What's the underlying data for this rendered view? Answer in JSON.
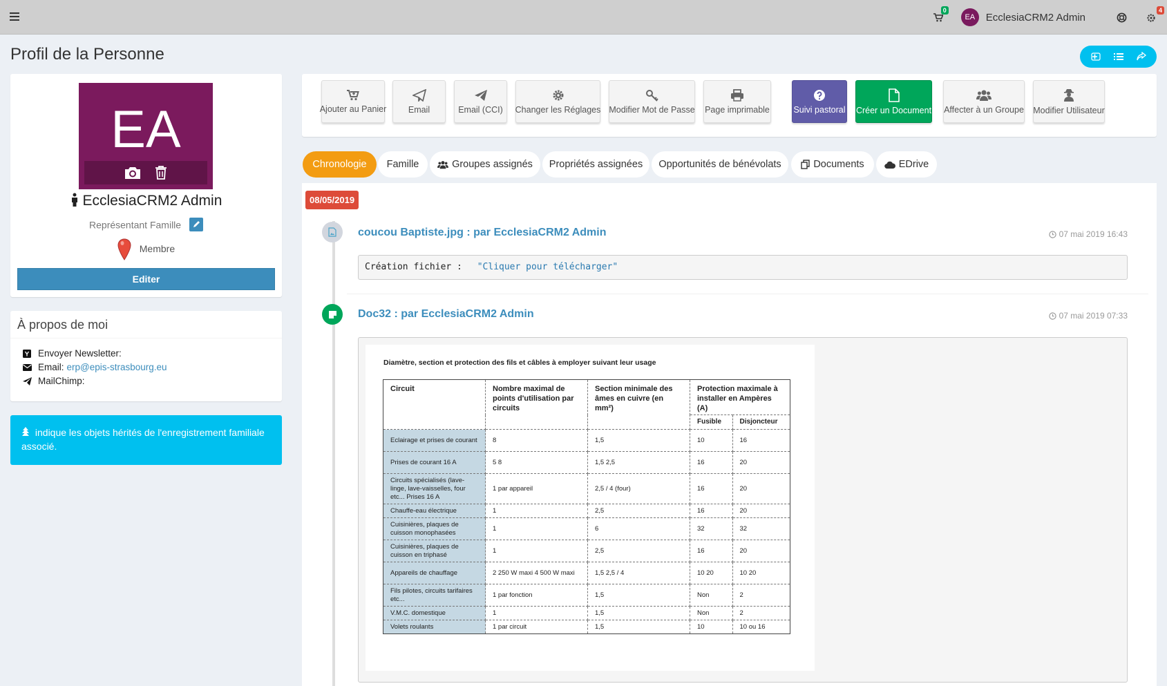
{
  "topbar": {
    "cart_count": "0",
    "user_initials": "EA",
    "user_name": "EcclesiaCRM2 Admin",
    "notif_count": "4"
  },
  "page": {
    "title": "Profil de la Personne"
  },
  "profile": {
    "initials": "EA",
    "name": "EcclesiaCRM2 Admin",
    "role": "Représentant Famille",
    "classification": "Membre",
    "edit_label": "Editer"
  },
  "about": {
    "title": "À propos de moi",
    "newsletter_label": "Envoyer Newsletter:",
    "email_label": "Email:",
    "email_value": "erp@epis-strasbourg.eu",
    "mailchimp_label": "MailChimp:"
  },
  "info": {
    "text": "indique les objets hérités de l'enregistrement familiale associé."
  },
  "actions": [
    {
      "label": "Ajouter au Panier",
      "icon": "cart-plus-icon"
    },
    {
      "label": "Email",
      "icon": "paper-plane-outline-icon"
    },
    {
      "label": "Email (CCI)",
      "icon": "paper-plane-icon"
    },
    {
      "label": "Changer les Réglages",
      "icon": "gear-icon"
    },
    {
      "label": "Modifier Mot de Passe",
      "icon": "key-icon"
    },
    {
      "label": "Page imprimable",
      "icon": "print-icon"
    },
    {
      "label": "Suivi pastoral",
      "icon": "question-circle-icon"
    },
    {
      "label": "Créer un Document",
      "icon": "file-icon"
    },
    {
      "label": "Affecter à un Groupe",
      "icon": "users-icon"
    },
    {
      "label": "Modifier Utilisateur",
      "icon": "user-secret-icon"
    }
  ],
  "tabs": [
    {
      "label": "Chronologie"
    },
    {
      "label": "Famille"
    },
    {
      "label": "Groupes assignés"
    },
    {
      "label": "Propriétés assignées"
    },
    {
      "label": "Opportunités de bénévolats"
    },
    {
      "label": "Documents"
    },
    {
      "label": "EDrive"
    }
  ],
  "timeline": {
    "date_label": "08/05/2019",
    "item1": {
      "title": "coucou Baptiste.jpg : par EcclesiaCRM2 Admin",
      "time": "07 mai 2019 16:43",
      "code_label": "Création fichier :",
      "code_value": "\"Cliquer pour télécharger\""
    },
    "item2": {
      "title": "Doc32 : par EcclesiaCRM2 Admin",
      "time": "07 mai 2019 07:33"
    }
  },
  "document": {
    "title": "Diamètre, section et protection des fils et câbles à employer suivant leur usage",
    "headers": {
      "circuit": "Circuit",
      "points": "Nombre maximal de points d'utilisation par circuits",
      "section": "Section minimale des âmes en cuivre (en mm²)",
      "protection": "Protection maximale à installer en Ampères (A)",
      "fusible": "Fusible",
      "disjoncteur": "Disjoncteur"
    },
    "rows": [
      {
        "circuit": "Eclairage et prises de courant",
        "points": "8",
        "section": "1,5",
        "fusible": "10",
        "disjoncteur": "16"
      },
      {
        "circuit": "Prises de courant 16 A",
        "points": "5 8",
        "section": "1,5 2,5",
        "fusible": "16",
        "disjoncteur": "20"
      },
      {
        "circuit": "Circuits spécialisés (lave-linge, lave-vaisselles, four etc... Prises 16 A",
        "points": "1 par appareil",
        "section": "2,5 / 4 (four)",
        "fusible": "16",
        "disjoncteur": "20"
      },
      {
        "circuit": "Chauffe-eau électrique",
        "points": "1",
        "section": "2,5",
        "fusible": "16",
        "disjoncteur": "20"
      },
      {
        "circuit": "Cuisinières, plaques de cuisson monophasées",
        "points": "1",
        "section": "6",
        "fusible": "32",
        "disjoncteur": "32"
      },
      {
        "circuit": "Cuisinières, plaques de cuisson en triphasé",
        "points": "1",
        "section": "2,5",
        "fusible": "16",
        "disjoncteur": "20"
      },
      {
        "circuit": "Appareils de chauffage",
        "points": "2 250 W maxi 4 500 W maxi",
        "section": "1,5 2,5 / 4",
        "fusible": "10 20",
        "disjoncteur": "10 20"
      },
      {
        "circuit": "Fils pilotes, circuits tarifaires etc...",
        "points": "1 par fonction",
        "section": "1,5",
        "fusible": "Non",
        "disjoncteur": "2"
      },
      {
        "circuit": "V.M.C. domestique",
        "points": "1",
        "section": "1,5",
        "fusible": "Non",
        "disjoncteur": "2"
      },
      {
        "circuit": "Volets roulants",
        "points": "1 par circuit",
        "section": "1,5",
        "fusible": "10",
        "disjoncteur": "10 ou 16"
      }
    ]
  },
  "colors": {
    "primary": "#3c8dbc",
    "orange": "#f39c12",
    "purple": "#605ca8",
    "green": "#00a65a",
    "aqua": "#00c0ef",
    "red": "#dd4b39",
    "avatar": "#7b1a5d"
  }
}
